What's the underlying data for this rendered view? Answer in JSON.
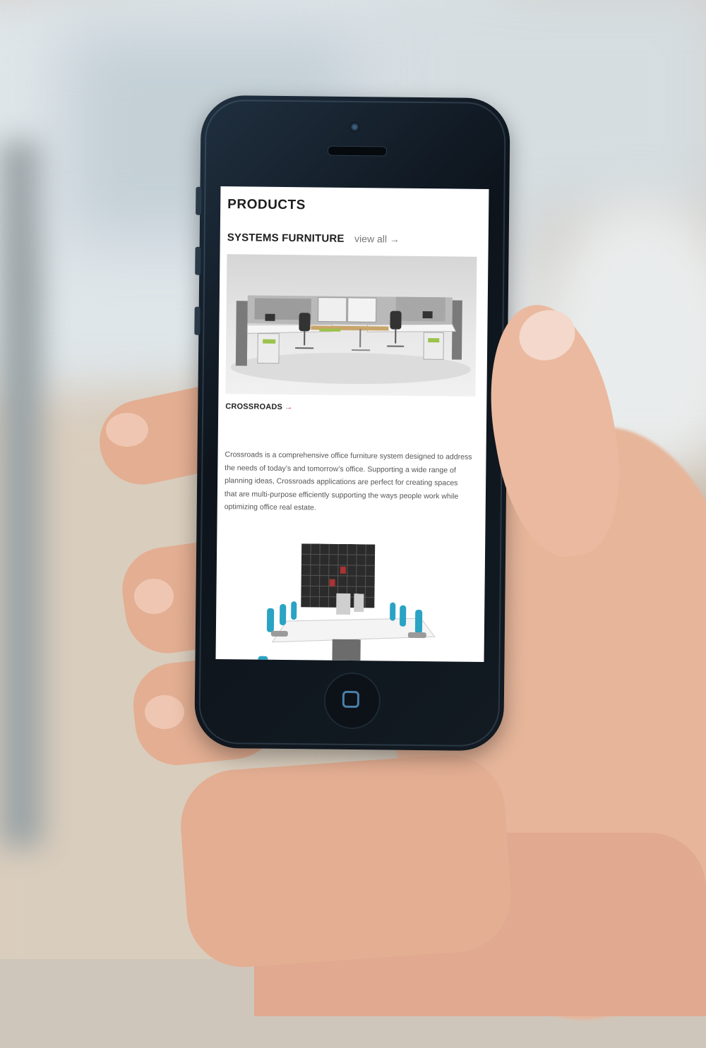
{
  "screen": {
    "page_title": "PRODUCTS",
    "section_title": "SYSTEMS FURNITURE",
    "view_all_label": "view all",
    "view_all_arrow": "→",
    "product_name": "CROSSROADS",
    "product_arrow": "→",
    "description": "Crossroads is a comprehensive office furniture system designed to address the needs of today’s and tomorrow’s office. Supporting a wide range of planning ideas, Crossroads applications are perfect for creating spaces that are multi-purpose efficiently supporting the ways people work while optimizing office real estate."
  },
  "colors": {
    "accent_arrow": "#c0312b",
    "chair_accent": "#2aa3c4",
    "seat_accent": "#9bc24a",
    "phone_body": "#121a22"
  }
}
